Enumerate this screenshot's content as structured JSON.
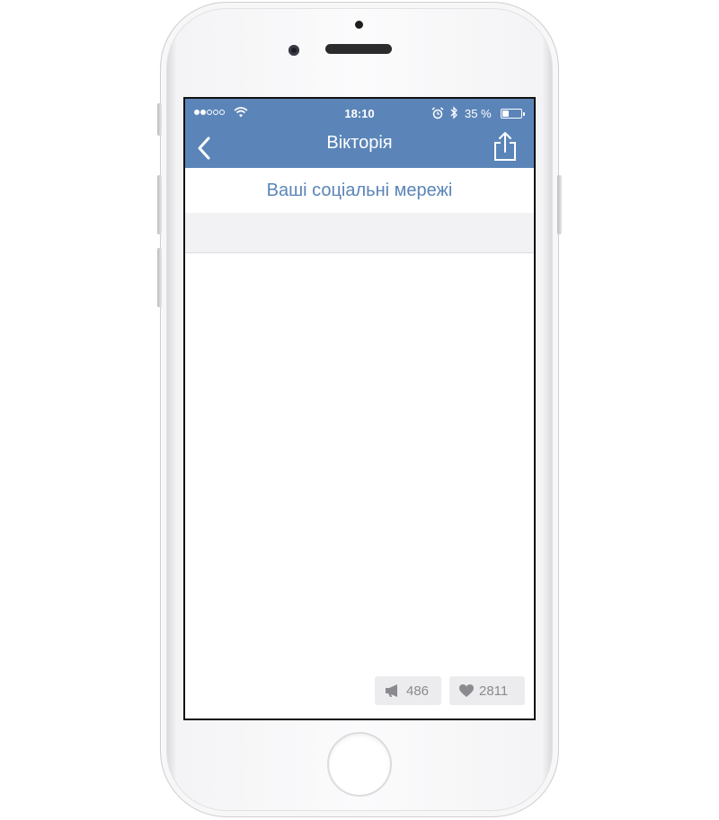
{
  "status_bar": {
    "time": "18:10",
    "battery_percent": "35 %",
    "signal_bars_filled": 2,
    "signal_bars_total": 5,
    "battery_level": 0.35
  },
  "nav": {
    "title": "Вікторія",
    "back_icon": "chevron-left-icon",
    "share_icon": "share-icon"
  },
  "content": {
    "section_title": "Ваші соціальні мережі"
  },
  "actions": {
    "reposts": "486",
    "likes": "2811",
    "repost_icon": "megaphone-icon",
    "like_icon": "heart-icon"
  },
  "colors": {
    "accent": "#5b85b8",
    "band": "#f2f2f5",
    "button_bg": "#ececef",
    "button_text": "#8a8a8f"
  }
}
